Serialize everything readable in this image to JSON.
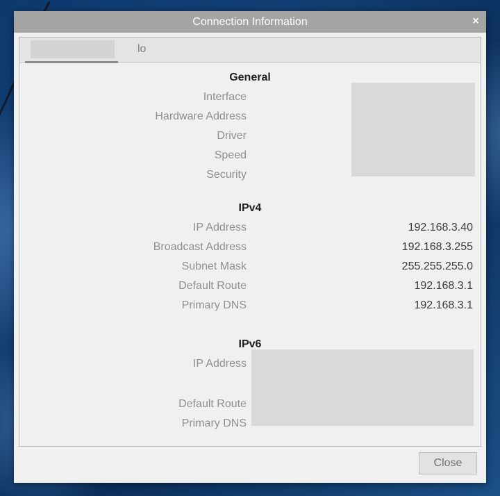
{
  "window": {
    "title": "Connection Information",
    "close_glyph": "×"
  },
  "tabs": [
    {
      "label": "",
      "active": true,
      "redacted": true
    },
    {
      "label": "lo",
      "active": false
    }
  ],
  "general": {
    "heading": "General",
    "labels": [
      "Interface",
      "Hardware Address",
      "Driver",
      "Speed",
      "Security"
    ],
    "values_redacted": true
  },
  "ipv4": {
    "heading": "IPv4",
    "rows": [
      {
        "label": "IP Address",
        "value": "192.168.3.40"
      },
      {
        "label": "Broadcast Address",
        "value": "192.168.3.255"
      },
      {
        "label": "Subnet Mask",
        "value": "255.255.255.0"
      },
      {
        "label": "Default Route",
        "value": "192.168.3.1"
      },
      {
        "label": "Primary DNS",
        "value": "192.168.3.1"
      }
    ]
  },
  "ipv6": {
    "heading": "IPv6",
    "labels": [
      "IP Address",
      "Default Route",
      "Primary DNS"
    ],
    "values_redacted": true
  },
  "buttons": {
    "close_label": "Close"
  },
  "colors": {
    "titlebar": "#a4a4a4",
    "dialog_bg": "#f0f0f0",
    "label_text": "#8f8f8f",
    "value_text": "#3a3a3a",
    "redaction": "#d9d9d9"
  }
}
